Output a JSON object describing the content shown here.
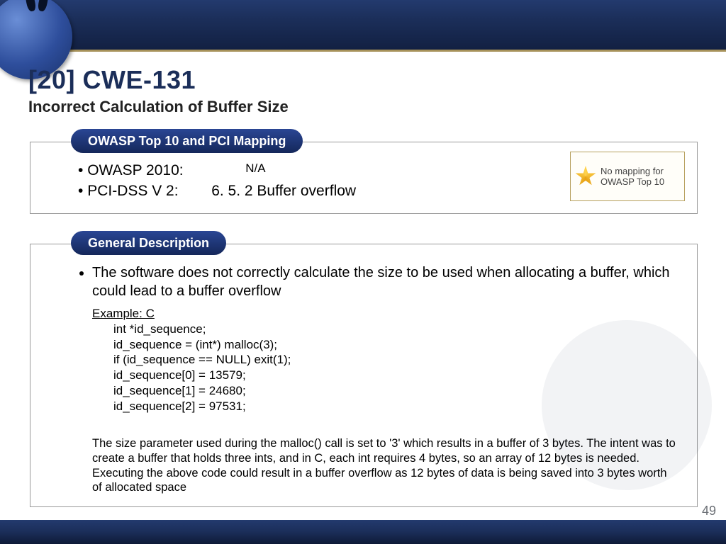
{
  "title": "[20] CWE-131",
  "subtitle": "Incorrect Calculation of Buffer Size",
  "sections": {
    "mapping_header": "OWASP Top 10 and PCI Mapping",
    "description_header": "General Description"
  },
  "mapping": {
    "owasp": {
      "label": "OWASP 2010:",
      "value": "N/A"
    },
    "pci": {
      "label": "PCI-DSS V 2:",
      "value": "6. 5. 2 Buffer overflow"
    }
  },
  "badge": "No mapping for OWASP Top 10",
  "description_bullet": "The software does not correctly calculate the size to be used when allocating a buffer, which could lead to a buffer overflow",
  "example": {
    "header": "Example: C",
    "lines": [
      "int *id_sequence;",
      "id_sequence = (int*) malloc(3);",
      "if (id_sequence == NULL) exit(1);",
      "id_sequence[0] = 13579;",
      "id_sequence[1] = 24680;",
      "id_sequence[2] = 97531;"
    ],
    "explanation": "The size parameter used during the malloc() call is set to '3' which results in a buffer of 3 bytes. The intent was to create a buffer that holds three ints, and in C, each int requires 4 bytes, so an array of 12 bytes is needed. Executing the above code could result in a buffer overflow as 12 bytes of data is being saved into 3 bytes worth of allocated space"
  },
  "page_number": "49"
}
